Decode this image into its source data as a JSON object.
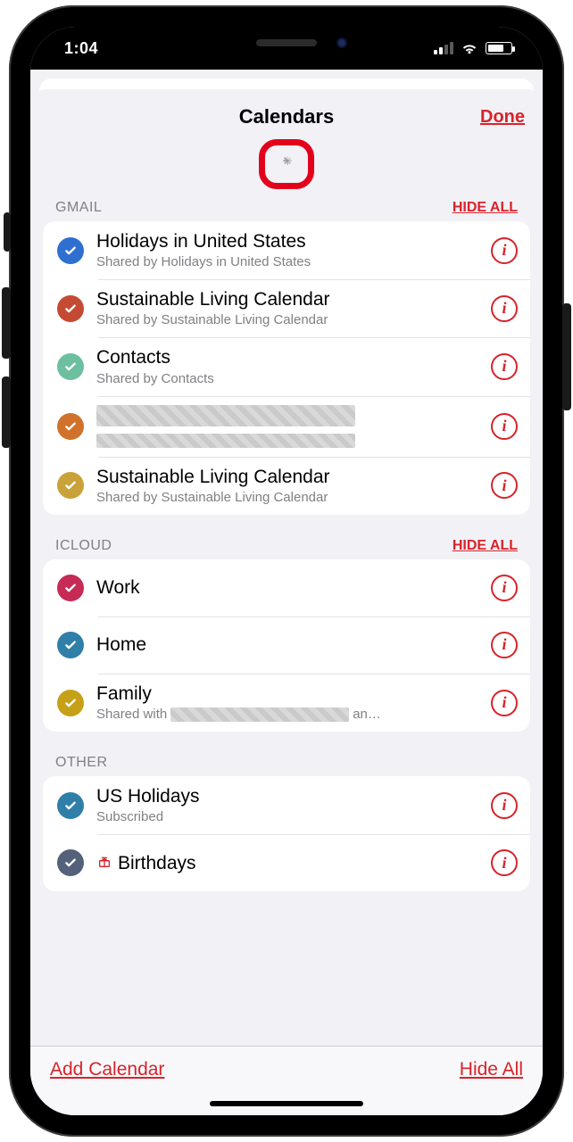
{
  "status": {
    "time": "1:04"
  },
  "sheet": {
    "title": "Calendars",
    "done": "Done"
  },
  "toolbar": {
    "add": "Add Calendar",
    "hideall": "Hide All"
  },
  "sections": [
    {
      "label": "GMAIL",
      "action": "HIDE ALL",
      "items": [
        {
          "title": "Holidays in United States",
          "subtitle": "Shared by Holidays in United States",
          "color": "#2f6fd0"
        },
        {
          "title": "Sustainable Living Calendar",
          "subtitle": "Shared by Sustainable Living Calendar",
          "color": "#c44a33"
        },
        {
          "title": "Contacts",
          "subtitle": "Shared by Contacts",
          "color": "#6cbf9f"
        },
        {
          "title": "",
          "subtitle": "",
          "color": "#d0722b",
          "redacted": true
        },
        {
          "title": "Sustainable Living Calendar",
          "subtitle": "Shared by Sustainable Living Calendar",
          "color": "#c9a23a"
        }
      ]
    },
    {
      "label": "ICLOUD",
      "action": "HIDE ALL",
      "items": [
        {
          "title": "Work",
          "subtitle": "",
          "color": "#c52b55"
        },
        {
          "title": "Home",
          "subtitle": "",
          "color": "#2f7fa8"
        },
        {
          "title": "Family",
          "sub_prefix": "Shared with",
          "sub_suffix": "an…",
          "color": "#c6a017",
          "partial_redact": true
        }
      ]
    },
    {
      "label": "OTHER",
      "action": "",
      "items": [
        {
          "title": "US Holidays",
          "subtitle": "Subscribed",
          "color": "#2f7fa8"
        },
        {
          "title": "Birthdays",
          "subtitle": "",
          "color": "#54617a",
          "gift": true
        }
      ]
    }
  ]
}
